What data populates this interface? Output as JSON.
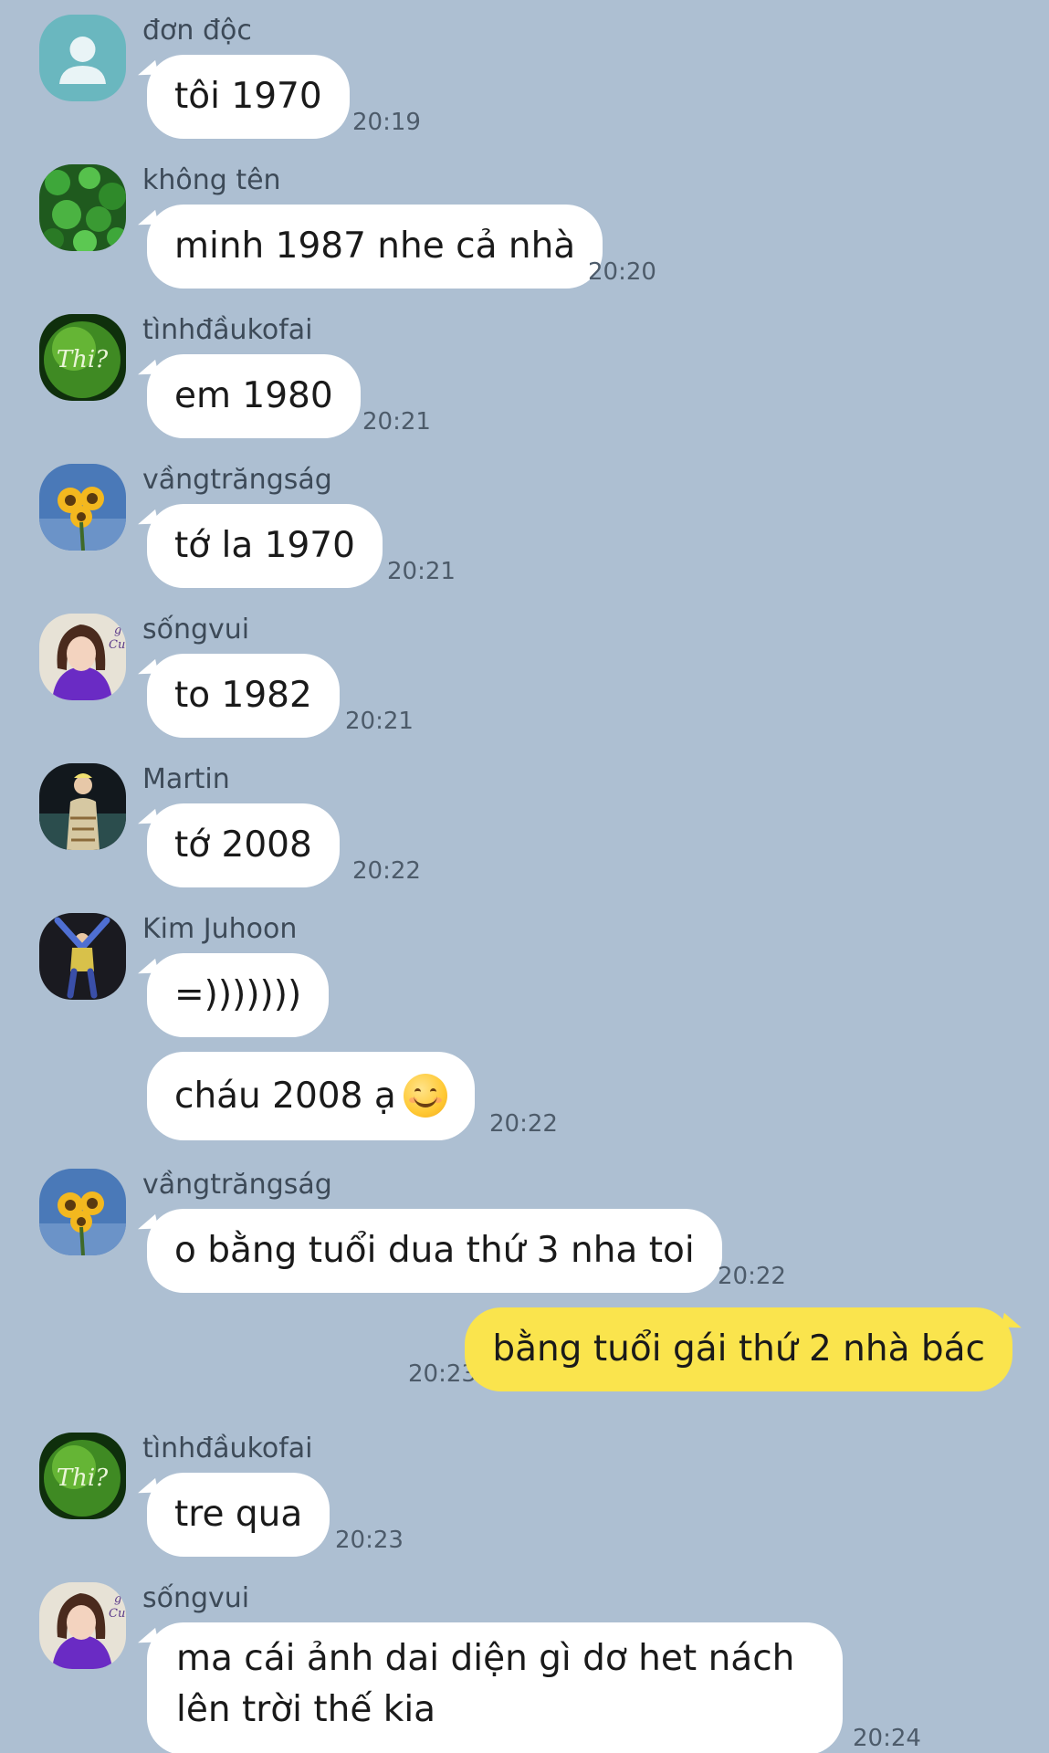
{
  "messages": [
    {
      "sender": "đơn độc",
      "text": "tôi 1970",
      "time": "20:19"
    },
    {
      "sender": "không tên",
      "text": "minh 1987 nhe cả nhà",
      "time": "20:20"
    },
    {
      "sender": "tìnhđầukofai",
      "text": "em 1980",
      "time": "20:21"
    },
    {
      "sender": "vầngtrăngság",
      "text": "tớ la 1970",
      "time": "20:21"
    },
    {
      "sender": "sốngvui",
      "text": "to 1982",
      "time": "20:21"
    },
    {
      "sender": "Martin",
      "text": "tớ 2008",
      "time": "20:22"
    },
    {
      "sender": "Kim Juhoon",
      "text": "=)))))))",
      "text2": "cháu 2008 ạ",
      "time2": "20:22"
    },
    {
      "sender": "vầngtrăngság",
      "text": "o bằng tuổi dua thứ 3 nha toi",
      "time": "20:22"
    },
    {
      "outgoing": true,
      "text": "bằng tuổi gái thứ 2 nhà bác",
      "time": "20:23"
    },
    {
      "sender": "tìnhđầukofai",
      "text": "tre qua",
      "time": "20:23"
    },
    {
      "sender": "sốngvui",
      "text": "ma cái ảnh dai diện gì dơ het nách lên trời thế kia",
      "time": "20:24"
    }
  ],
  "avatars": {
    "default": "person-silhouette-icon",
    "khong_ten": "green-plant",
    "tinhdau": "green-apple-thi",
    "vangtrang": "sunflower",
    "songvui": "girl-portrait",
    "martin": "person-night",
    "kim": "person-arms-raised"
  },
  "emoji": "smiling-face-emoji",
  "colors": {
    "background": "#adbfd2",
    "incoming_bubble": "#ffffff",
    "outgoing_bubble": "#fae44d"
  }
}
